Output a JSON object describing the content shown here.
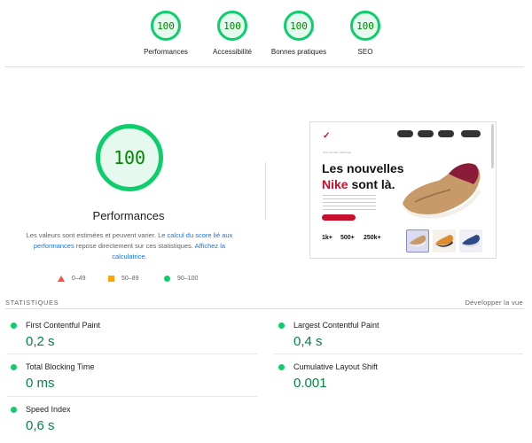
{
  "top_categories": [
    {
      "score": "100",
      "label": "Performances"
    },
    {
      "score": "100",
      "label": "Accessibilité"
    },
    {
      "score": "100",
      "label": "Bonnes pratiques"
    },
    {
      "score": "100",
      "label": "SEO"
    }
  ],
  "main": {
    "score": "100",
    "title": "Performances",
    "description": {
      "part1": "Les valeurs sont estimées et peuvent varier. Le ",
      "link1": "calcul du score lié aux performances",
      "part2": " repose directement sur ces statistiques. ",
      "link2": "Affichez la calculatrice",
      "part3": "."
    },
    "legend": [
      {
        "shape": "triangle",
        "range": "0–49",
        "color": "#ff4e42"
      },
      {
        "shape": "square",
        "range": "50–89",
        "color": "#ffa400"
      },
      {
        "shape": "circle",
        "range": "90–100",
        "color": "#0cce6b"
      }
    ]
  },
  "screenshot": {
    "logo": "✓",
    "tagline": "Une nouvelle chaussure",
    "headline_line1": "Les nouvelles",
    "headline_brand": "Nike",
    "headline_rest": " sont là.",
    "stats": [
      "1k+",
      "500+",
      "250k+"
    ]
  },
  "statistics": {
    "header": "STATISTIQUES",
    "expand_label": "Développer la vue",
    "metrics": [
      {
        "name": "First Contentful Paint",
        "value": "0,2 s"
      },
      {
        "name": "Largest Contentful Paint",
        "value": "0,4 s"
      },
      {
        "name": "Total Blocking Time",
        "value": "0 ms"
      },
      {
        "name": "Cumulative Layout Shift",
        "value": "0.001"
      },
      {
        "name": "Speed Index",
        "value": "0,6 s"
      }
    ]
  },
  "colors": {
    "pass": "#0cce6b",
    "average": "#ffa400",
    "fail": "#ff4e42",
    "pass_text": "#018642"
  }
}
